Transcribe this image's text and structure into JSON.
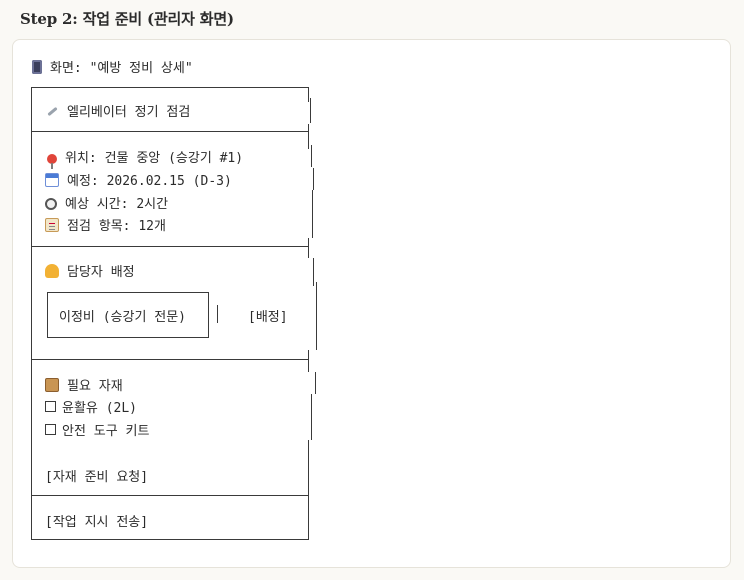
{
  "step_title": "Step 2: 작업 준비 (관리자 화면)",
  "screen": {
    "label": "화면: \"예방 정비 상세\"",
    "icon": "mobile-phone-icon"
  },
  "task": {
    "icon": "wrench-icon",
    "title": "엘리베이터 정기 점검"
  },
  "details": [
    {
      "icon": "pin-icon",
      "text": "위치: 건물 중앙 (승강기 #1)"
    },
    {
      "icon": "calendar-icon",
      "text": "예정: 2026.02.15 (D-3)"
    },
    {
      "icon": "stopwatch-icon",
      "text": "예상 시간: 2시간"
    },
    {
      "icon": "clipboard-icon",
      "text": "점검 항목: 12개"
    }
  ],
  "assignment": {
    "icon": "worker-icon",
    "heading": "담당자 배정",
    "assignee": "이정비 (승강기 전문)",
    "assign_button": "[배정]"
  },
  "materials": {
    "icon": "package-icon",
    "heading": "필요 자재",
    "items": [
      "윤활유 (2L)",
      "안전 도구 키트"
    ],
    "request_button": "[자재 준비 요청]"
  },
  "send_button": "[작업 지시 전송]"
}
